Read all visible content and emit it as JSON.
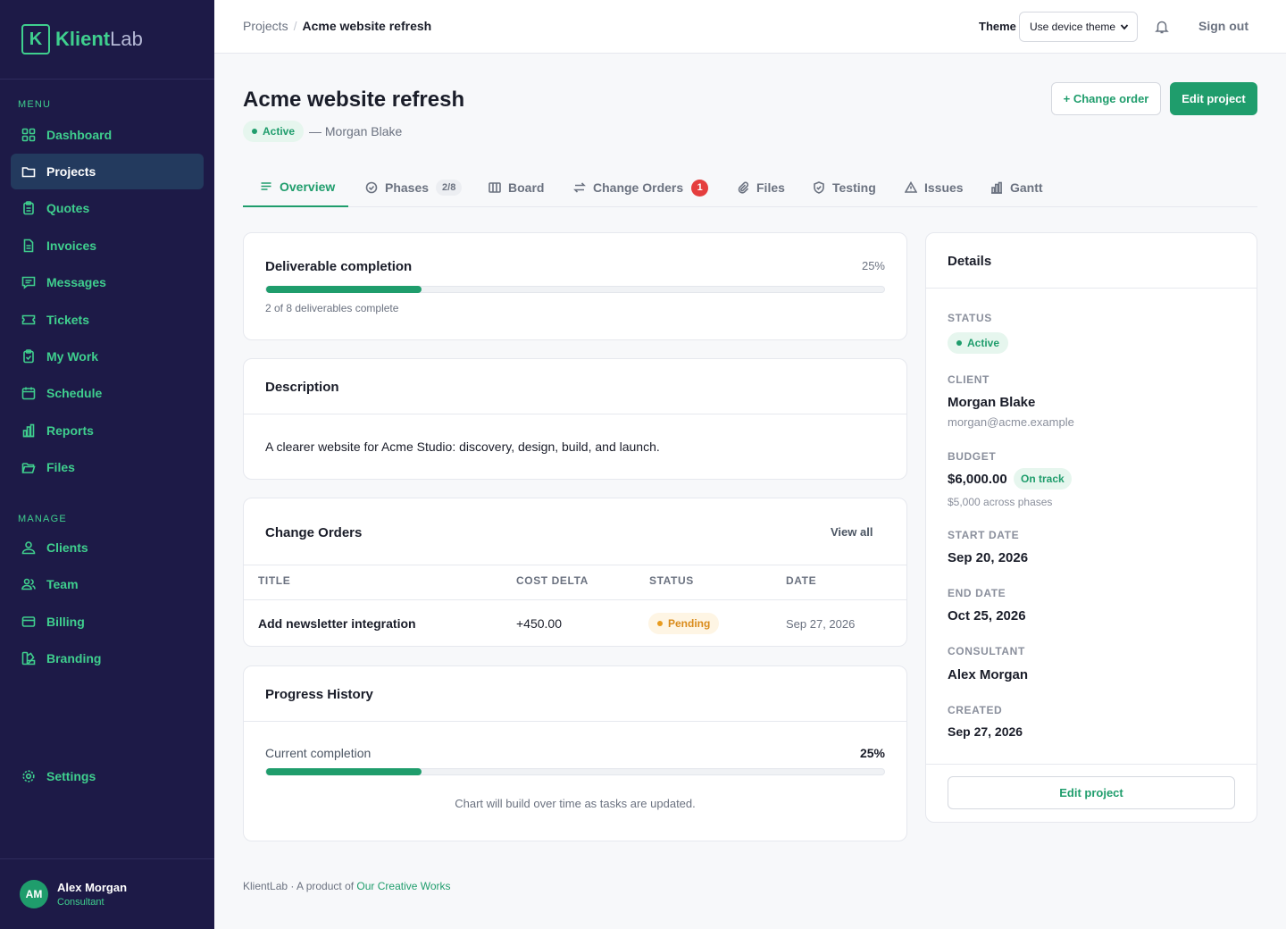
{
  "brand": {
    "mark": "K",
    "name_a": "Klient",
    "name_b": "Lab"
  },
  "sidebar": {
    "menu_label": "MENU",
    "manage_label": "MANAGE",
    "items": [
      {
        "label": "Dashboard",
        "icon": "grid-icon"
      },
      {
        "label": "Projects",
        "icon": "folder-icon",
        "active": true
      },
      {
        "label": "Quotes",
        "icon": "clipboard-icon"
      },
      {
        "label": "Invoices",
        "icon": "document-icon"
      },
      {
        "label": "Messages",
        "icon": "chat-icon"
      },
      {
        "label": "Tickets",
        "icon": "ticket-icon"
      },
      {
        "label": "My Work",
        "icon": "clipboard-check-icon"
      },
      {
        "label": "Schedule",
        "icon": "calendar-icon"
      },
      {
        "label": "Reports",
        "icon": "bar-chart-icon"
      },
      {
        "label": "Files",
        "icon": "folder-open-icon"
      }
    ],
    "manage_items": [
      {
        "label": "Clients",
        "icon": "users-icon"
      },
      {
        "label": "Team",
        "icon": "team-icon"
      },
      {
        "label": "Billing",
        "icon": "credit-card-icon"
      },
      {
        "label": "Branding",
        "icon": "palette-icon"
      }
    ],
    "settings_label": "Settings",
    "user": {
      "initials": "AM",
      "name": "Alex Morgan",
      "role": "Consultant"
    }
  },
  "topbar": {
    "breadcrumb_root": "Projects",
    "breadcrumb_sep": "/",
    "breadcrumb_current": "Acme website refresh",
    "theme_label": "Theme",
    "theme_value": "Use device theme",
    "signout": "Sign out"
  },
  "header": {
    "title": "Acme website refresh",
    "status": "Active",
    "client_line": "— Morgan Blake",
    "change_order_btn": "+ Change order",
    "edit_btn": "Edit project"
  },
  "tabs": [
    {
      "label": "Overview",
      "icon": "lines-icon"
    },
    {
      "label": "Phases",
      "icon": "check-circle-icon",
      "count": "2/8"
    },
    {
      "label": "Board",
      "icon": "columns-icon"
    },
    {
      "label": "Change Orders",
      "icon": "swap-icon",
      "badge": "1"
    },
    {
      "label": "Files",
      "icon": "paperclip-icon"
    },
    {
      "label": "Testing",
      "icon": "shield-check-icon"
    },
    {
      "label": "Issues",
      "icon": "warning-icon"
    },
    {
      "label": "Gantt",
      "icon": "bar-chart-icon"
    }
  ],
  "completion": {
    "title": "Deliverable completion",
    "percent_label": "25%",
    "fraction": 0.25,
    "subtitle": "2 of 8 deliverables complete"
  },
  "description": {
    "title": "Description",
    "text": "A clearer website for Acme Studio: discovery, design, build, and launch."
  },
  "change_orders": {
    "title": "Change Orders",
    "view_all": "View all",
    "columns": [
      "TITLE",
      "COST DELTA",
      "STATUS",
      "DATE"
    ],
    "rows": [
      {
        "title": "Add newsletter integration",
        "cost": "+450.00",
        "status": "Pending",
        "date": "Sep 27, 2026"
      }
    ]
  },
  "progress_history": {
    "title": "Progress History",
    "label": "Current completion",
    "percent_label": "25%",
    "fraction": 0.25,
    "note": "Chart will build over time as tasks are updated."
  },
  "details": {
    "title": "Details",
    "status_label": "STATUS",
    "status": "Active",
    "client_label": "CLIENT",
    "client_name": "Morgan Blake",
    "client_email": "morgan@acme.example",
    "budget_label": "BUDGET",
    "budget": "$6,000.00",
    "budget_badge": "On track",
    "budget_note": "$5,000 across phases",
    "start_label": "START DATE",
    "start": "Sep 20, 2026",
    "end_label": "END DATE",
    "end": "Oct 25, 2026",
    "consultant_label": "CONSULTANT",
    "consultant": "Alex Morgan",
    "created_label": "CREATED",
    "created": "Sep 27, 2026",
    "edit_btn": "Edit project"
  },
  "footer": {
    "prefix": "KlientLab · A product of ",
    "link": "Our Creative Works"
  },
  "colors": {
    "accent": "#1f9d6c",
    "sidebar_bg": "#1d1a47",
    "danger": "#e53e3e",
    "warning": "#d98b1b"
  }
}
